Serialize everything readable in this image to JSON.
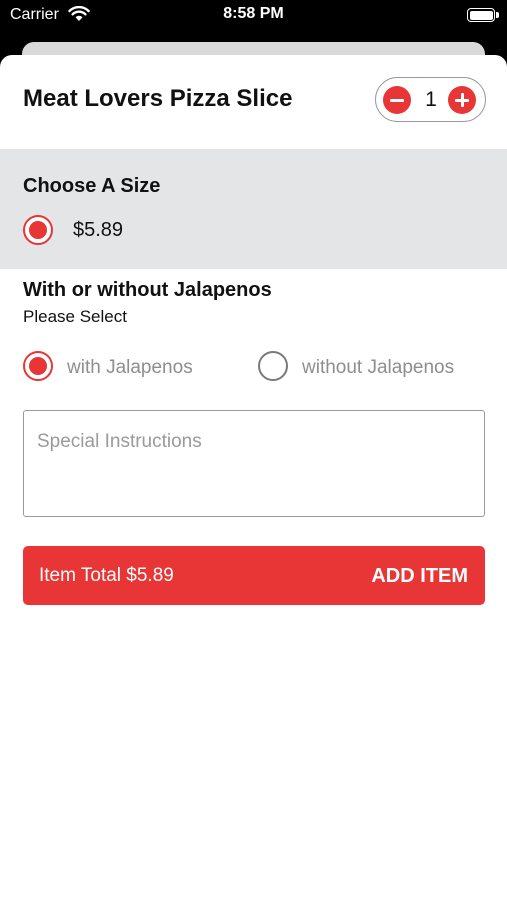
{
  "status_bar": {
    "carrier": "Carrier",
    "time": "8:58 PM"
  },
  "item": {
    "title": "Meat Lovers Pizza Slice",
    "quantity": "1"
  },
  "size_section": {
    "title": "Choose A Size",
    "options": [
      {
        "label": "$5.89",
        "selected": true
      }
    ]
  },
  "jalapenos_section": {
    "title": "With or without Jalapenos",
    "subtitle": "Please Select",
    "options": [
      {
        "label": "with Jalapenos",
        "selected": true
      },
      {
        "label": "without Jalapenos",
        "selected": false
      }
    ]
  },
  "instructions": {
    "placeholder": "Special Instructions"
  },
  "add_bar": {
    "total_label": "Item Total $5.89",
    "button_label": "ADD ITEM"
  },
  "colors": {
    "accent": "#e83535",
    "section_background": "#e4e5e7",
    "muted_text": "#8e8e8e"
  },
  "icons": [
    "wifi-icon",
    "battery-icon",
    "minus-icon",
    "plus-icon"
  ]
}
